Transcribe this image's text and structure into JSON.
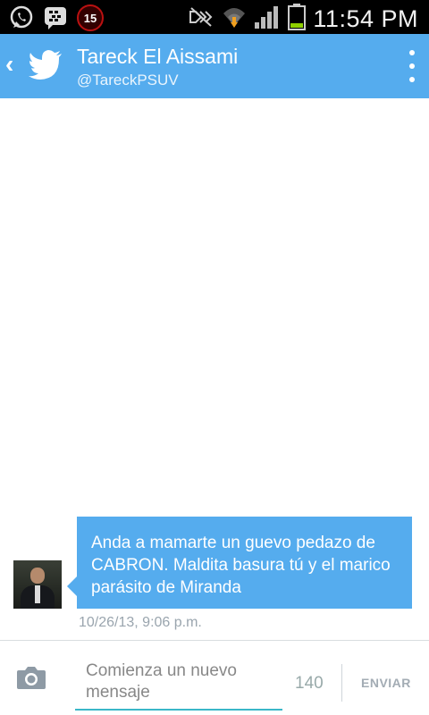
{
  "status_bar": {
    "time": "11:54 PM",
    "notification_count": "15",
    "icons": [
      "whatsapp-icon",
      "bbm-icon",
      "notification-badge",
      "mute-icon",
      "wifi-icon",
      "signal-icon",
      "battery-icon"
    ]
  },
  "header": {
    "name": "Tareck El Aissami",
    "handle": "@TareckPSUV",
    "accent_color": "#55acee"
  },
  "conversation": {
    "messages": [
      {
        "text": "Anda a mamarte un guevo pedazo de CABRON. Maldita basura tú y el marico parásito de Miranda",
        "timestamp": "10/26/13, 9:06 p.m."
      }
    ]
  },
  "composer": {
    "placeholder": "Comienza un nuevo mensaje",
    "char_count": "140",
    "send_label": "ENVIAR"
  }
}
